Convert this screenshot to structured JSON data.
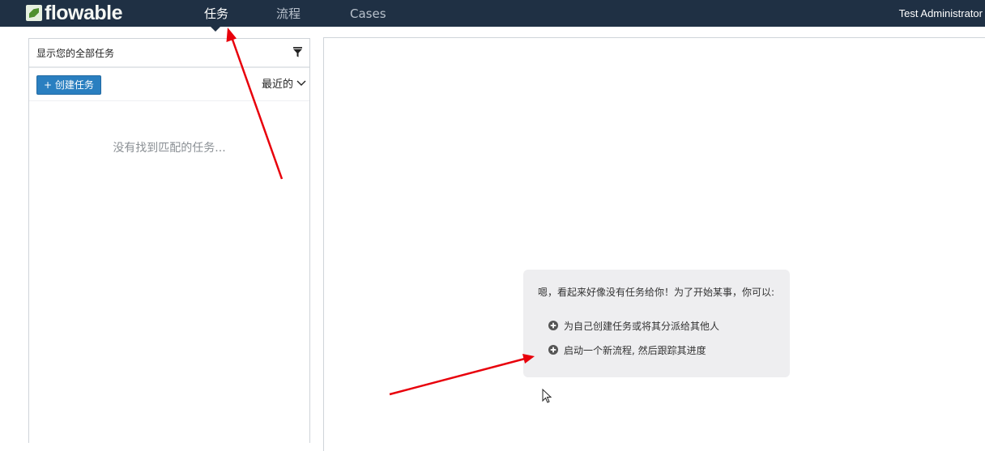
{
  "brand": {
    "logo_text": "flowable",
    "logo_color": "#4f8f2f"
  },
  "nav": {
    "items": [
      {
        "label": "任务",
        "active": true
      },
      {
        "label": "流程",
        "active": false
      },
      {
        "label": "Cases",
        "active": false
      }
    ],
    "user": "Test Administrator",
    "background": "#1f3044"
  },
  "tasks_panel": {
    "filter_title": "显示您的全部任务",
    "create_button": "+ 创建任务",
    "sort_label": "最近的",
    "empty_message": "没有找到匹配的任务..."
  },
  "help": {
    "intro": "嗯，看起来好像没有任务给你！为了开始某事，你可以:",
    "options": [
      "为自己创建任务或将其分派给其他人",
      "启动一个新流程, 然后跟踪其进度"
    ]
  },
  "colors": {
    "accent": "#2a7fc0",
    "annotation": "#e8000b"
  }
}
